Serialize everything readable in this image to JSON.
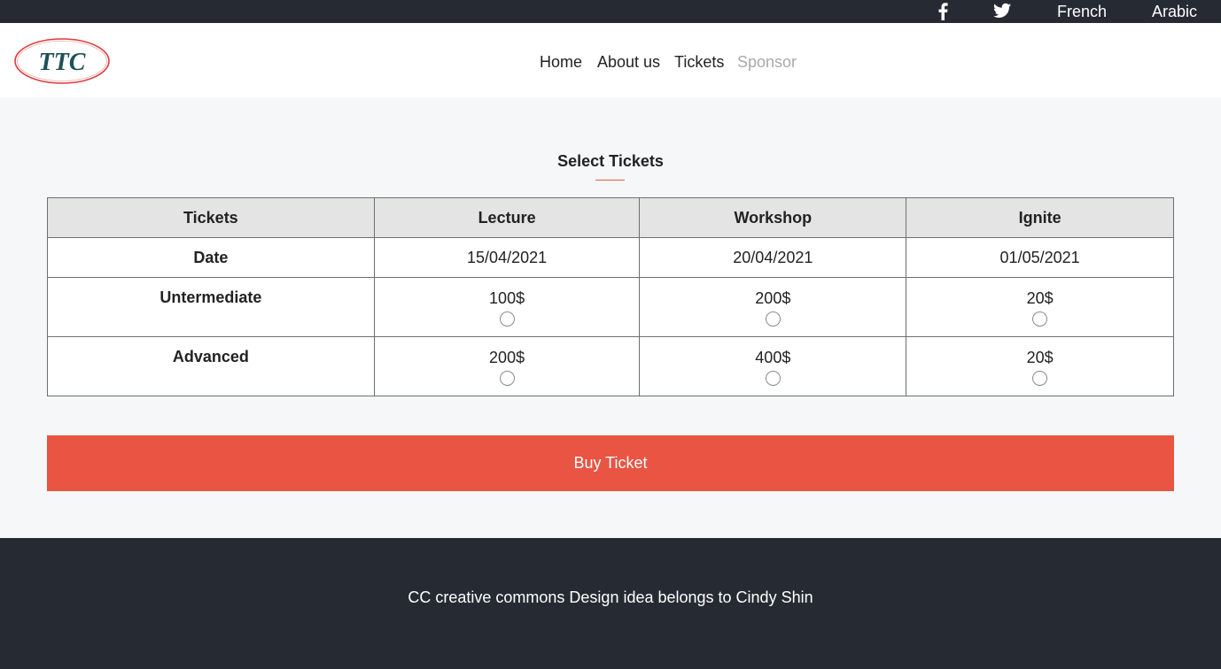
{
  "topbar": {
    "facebook_icon": "facebook-icon",
    "twitter_icon": "twitter-icon",
    "french": "French",
    "arabic": "Arabic"
  },
  "logo": {
    "text": "TTC"
  },
  "nav": {
    "home": "Home",
    "about": "About us",
    "tickets": "Tickets",
    "sponsor": "Sponsor"
  },
  "section": {
    "title": "Select Tickets"
  },
  "table": {
    "headers": [
      "Tickets",
      "Lecture",
      "Workshop",
      "Ignite"
    ],
    "date_row": {
      "label": "Date",
      "values": [
        "15/04/2021",
        "20/04/2021",
        "01/05/2021"
      ]
    },
    "intermediate_row": {
      "label": "Untermediate",
      "values": [
        "100$",
        "200$",
        "20$"
      ]
    },
    "advanced_row": {
      "label": "Advanced",
      "values": [
        "200$",
        "400$",
        "20$"
      ]
    }
  },
  "buy_button": "Buy Ticket",
  "footer": {
    "text": "CC creative commons Design idea belongs to Cindy Shin"
  },
  "colors": {
    "dark_bar": "#262a33",
    "accent": "#e95443",
    "page_background": "#f6f7f9",
    "table_header": "#e4e4e4"
  }
}
